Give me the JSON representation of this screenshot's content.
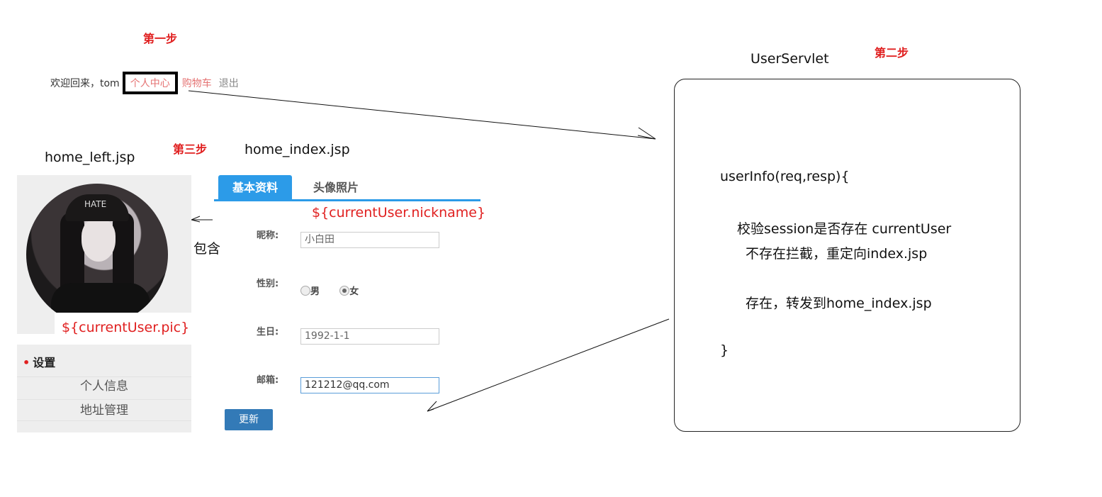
{
  "steps": {
    "step1": "第一步",
    "step2": "第二步",
    "step3": "第三步"
  },
  "topbar": {
    "welcome": "欢迎回来，tom",
    "personal_center": "个人中心",
    "cart": "购物车",
    "logout": "退出"
  },
  "files": {
    "left": "home_left.jsp",
    "index": "home_index.jsp",
    "servlet": "UserServlet"
  },
  "include_label": "包含",
  "left_panel": {
    "pic_expr": "${currentUser.pic}",
    "avatar_cap_text": "HATE",
    "menu_title": "设置",
    "menu_items": [
      "个人信息",
      "地址管理"
    ]
  },
  "form": {
    "tabs": [
      "基本资料",
      "头像照片"
    ],
    "nickname_expr": "${currentUser.nickname}",
    "nickname_label": "昵称:",
    "nickname_value": "小白田",
    "gender_label": "性别:",
    "gender_male": "男",
    "gender_female": "女",
    "gender_selected": "女",
    "birthday_label": "生日:",
    "birthday_value": "1992-1-1",
    "email_label": "邮箱:",
    "email_value": "121212@qq.com",
    "update_button": "更新"
  },
  "servlet_code": {
    "line1": "userInfo(req,resp){",
    "line2": "校验session是否存在 currentUser",
    "line3": "不存在拦截，重定向index.jsp",
    "line4": "存在，转发到home_index.jsp",
    "line5": "}"
  },
  "colors": {
    "step_red": "#e02020",
    "tab_blue": "#2c9be8",
    "button_blue": "#337ab7",
    "link_pink": "#e57373"
  }
}
